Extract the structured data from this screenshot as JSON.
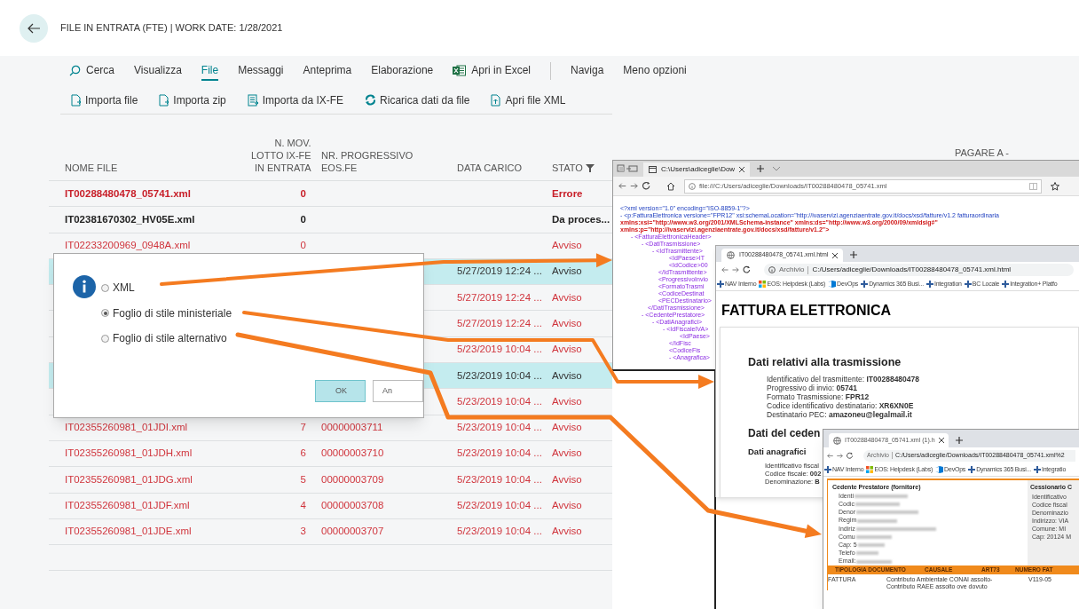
{
  "page": {
    "title": "FILE IN ENTRATA (FTE) | WORK DATE: 1/28/2021"
  },
  "menu": [
    {
      "kind": "item",
      "label": "Cerca",
      "selected": false
    },
    {
      "kind": "item",
      "label": "Visualizza",
      "selected": false
    },
    {
      "kind": "item",
      "label": "File",
      "selected": true
    },
    {
      "kind": "item",
      "label": "Messaggi",
      "selected": false
    },
    {
      "kind": "item",
      "label": "Anteprima",
      "selected": false
    },
    {
      "kind": "item",
      "label": "Elaborazione",
      "selected": false
    },
    {
      "kind": "item",
      "label": "Apri in Excel",
      "selected": false
    },
    {
      "kind": "separator"
    },
    {
      "kind": "item",
      "label": "Naviga",
      "selected": false
    },
    {
      "kind": "item",
      "label": "Meno opzioni",
      "selected": false
    }
  ],
  "actions": [
    {
      "label": "Importa file"
    },
    {
      "label": "Importa zip"
    },
    {
      "label": "Importa da IX-FE"
    },
    {
      "label": "Ricarica dati da file"
    },
    {
      "label": "Apri file XML"
    }
  ],
  "table": {
    "columns": [
      [
        "NOME FILE"
      ],
      [
        "N. MOV.",
        "LOTTO IX-FE",
        "IN ENTRATA"
      ],
      [
        "NR. PROGRESSIVO",
        "EOS.FE"
      ],
      [
        "DATA CARICO"
      ],
      [
        "STATO"
      ]
    ],
    "partial_column": "PAGARE A -",
    "rows": [
      {
        "name": "IT00288480478_05741.xml",
        "lotto": "0",
        "status": "Errore",
        "kind": "error",
        "selected": false
      },
      {
        "name": "IT02381670302_HV05E.xml",
        "lotto": "0",
        "status": "Da proces...",
        "kind": "pending",
        "selected": false
      },
      {
        "name": "IT02233200969_0948A.xml",
        "lotto": "0",
        "status": "Avviso",
        "kind": "warning",
        "selected": false
      },
      {
        "date": "5/27/2019 12:24 ...",
        "status": "Avviso",
        "kind": "warning",
        "selected": true
      },
      {
        "date": "5/27/2019 12:24 ...",
        "status": "Avviso",
        "kind": "warning",
        "selected": false
      },
      {
        "date": "5/27/2019 12:24 ...",
        "status": "Avviso",
        "kind": "warning",
        "selected": false
      },
      {
        "date": "5/23/2019 10:04 ...",
        "status": "Avviso",
        "kind": "warning",
        "selected": false
      },
      {
        "date": "5/23/2019 10:04 ...",
        "status": "Avviso",
        "kind": "warning",
        "selected": true
      },
      {
        "date": "5/23/2019 10:04 ...",
        "status": "Avviso",
        "kind": "warning",
        "selected": false
      },
      {
        "name": "IT02355260981_01JDI.xml",
        "lotto": "7",
        "progressivo": "00000003711",
        "date": "5/23/2019 10:04 ...",
        "status": "Avviso",
        "kind": "warning",
        "selected": false
      },
      {
        "name": "IT02355260981_01JDH.xml",
        "lotto": "6",
        "progressivo": "00000003710",
        "date": "5/23/2019 10:04 ...",
        "status": "Avviso",
        "kind": "warning",
        "selected": false
      },
      {
        "name": "IT02355260981_01JDG.xml",
        "lotto": "5",
        "progressivo": "00000003709",
        "date": "5/23/2019 10:04 ...",
        "status": "Avviso",
        "kind": "warning",
        "selected": false
      },
      {
        "name": "IT02355260981_01JDF.xml",
        "lotto": "4",
        "progressivo": "00000003708",
        "date": "5/23/2019 10:04 ...",
        "status": "Avviso",
        "kind": "warning",
        "selected": false
      },
      {
        "name": "IT02355260981_01JDE.xml",
        "lotto": "3",
        "progressivo": "00000003707",
        "date": "5/23/2019 10:04 ...",
        "status": "Avviso",
        "kind": "warning",
        "selected": false
      }
    ]
  },
  "dialog": {
    "options": [
      {
        "label": "XML",
        "selected": false
      },
      {
        "label": "Foglio di stile ministeriale",
        "selected": true
      },
      {
        "label": "Foglio di stile alternativo",
        "selected": false
      }
    ],
    "buttons": [
      {
        "label": "OK",
        "default": true
      },
      {
        "label": "An",
        "default": false
      }
    ]
  },
  "xml_browser": {
    "tab": "C:\\Users\\adiceglie\\Dow",
    "url": "file:///C:/Users/adiceglie/Downloads/IT00288480478_05741.xml",
    "lines": [
      {
        "text": "<?xml version=\"1.0\" encoding=\"ISO-8859-1\"?>"
      },
      {
        "text": "- <p:FatturaElettronica versione=\"FPR12\" xsi:schemaLocation=\"http://ivaservizi.agenziaentrate.gov.it/docs/xsd/fatture/v1.2 fatturaordinaria",
        "continued": [
          "xmlns:xsi=\"http://www.w3.org/2001/XMLSchema-instance\" xmlns:ds=\"http://www.w3.org/2000/09/xmldsig#\"",
          "xmlns:p=\"http://ivaservizi.agenziaentrate.gov.it/docs/xsd/fatture/v1.2\">"
        ],
        "children": [
          {
            "text": "- <FatturaElettronicaHeader>",
            "children": [
              {
                "text": "- <DatiTrasmissione>",
                "children": [
                  {
                    "text": "- <IdTrasmittente>",
                    "children": [
                      {
                        "text": "<IdPaese>IT"
                      },
                      {
                        "text": "<IdCodice>00"
                      }
                    ]
                  },
                  {
                    "text": "</IdTrasmittente>"
                  },
                  {
                    "text": "<ProgressivoInvio"
                  },
                  {
                    "text": "<FormatoTrasmi"
                  },
                  {
                    "text": "<CodiceDestinat"
                  },
                  {
                    "text": "<PECDestinatario>"
                  }
                ]
              },
              {
                "text": "</DatiTrasmissione>"
              },
              {
                "text": "- <CedentePrestatore>",
                "children": [
                  {
                    "text": "- <DatiAnagrafici>",
                    "children": [
                      {
                        "text": "- <IdFiscaleIVA>",
                        "children": [
                          {
                            "text": "<IdPaese>"
                          }
                        ]
                      },
                      {
                        "text": "</IdFisc"
                      },
                      {
                        "text": "<CodiceFis"
                      },
                      {
                        "text": "- <Anagrafica>"
                      }
                    ]
                  }
                ]
              }
            ]
          }
        ]
      }
    ]
  },
  "html_browser": {
    "tab": "IT00288480478_05741.xml.html",
    "origin": "Archivio",
    "url": "C:/Users/adiceglie/Downloads/IT00288480478_05741.xml.html",
    "bookmarks": [
      "NAV Interno",
      "EOS: Helpdesk (Labs)",
      "DevOps",
      "Dynamics 365 Busi...",
      "Integration",
      "BC Locale",
      "Integration+ Platfo"
    ],
    "heading": "FATTURA ELETTRONICA",
    "section": "Dati relativi alla trasmissione",
    "fields": [
      {
        "label": "Identificativo del trasmittente:",
        "value": "IT00288480478"
      },
      {
        "label": "Progressivo di invio:",
        "value": "05741"
      },
      {
        "label": "Formato Trasmissione:",
        "value": "FPR12"
      },
      {
        "label": "Codice identificativo destinatario:",
        "value": "XR6XN0E"
      },
      {
        "label": "Destinatario PEC:",
        "value": "amazoneu@legalmail.it"
      }
    ],
    "section2": "Dati del ceden",
    "subsection": "Dati anagrafici",
    "fields2": [
      {
        "label": "Identificativo fiscal"
      },
      {
        "label": "Codice fiscale:",
        "value": "002"
      },
      {
        "label": "Denominazione:",
        "value": "B"
      }
    ]
  },
  "styled_browser": {
    "tab": "IT00288480478_05741.xml (1).h",
    "origin": "Archivio",
    "url": "C:/Users/adiceglie/Downloads/IT00288480478_05741.xml%2",
    "bookmarks": [
      "NAV Interno",
      "EOS: Helpdesk (Labs)",
      "DevOps",
      "Dynamics 365 Busi...",
      "Integratio"
    ],
    "supplier_title": "Cedente Prestatore (fornitore)",
    "supplier_labels": [
      "Identi",
      "Codic",
      "Denor",
      "Regim",
      "Indiriz",
      "Comu",
      "Cap: 5",
      "Telefo",
      "Email:"
    ],
    "customer_title": "Cessionario C",
    "customer_lines": [
      "Identificativo",
      "Codice fiscal",
      "Denominazio",
      "Indirizzo: VIA",
      "Comune: MI",
      "Cap: 20124 M"
    ],
    "columns": [
      "TIPOLOGIA DOCUMENTO",
      "CAUSALE",
      "ART73",
      "NUMERO FAT"
    ],
    "row": {
      "document_type": "FATTURA",
      "reason": "Contributo Ambientale CONAI assolto-Contributo RAEE assolto ove dovuto",
      "number": "V119-05"
    }
  }
}
